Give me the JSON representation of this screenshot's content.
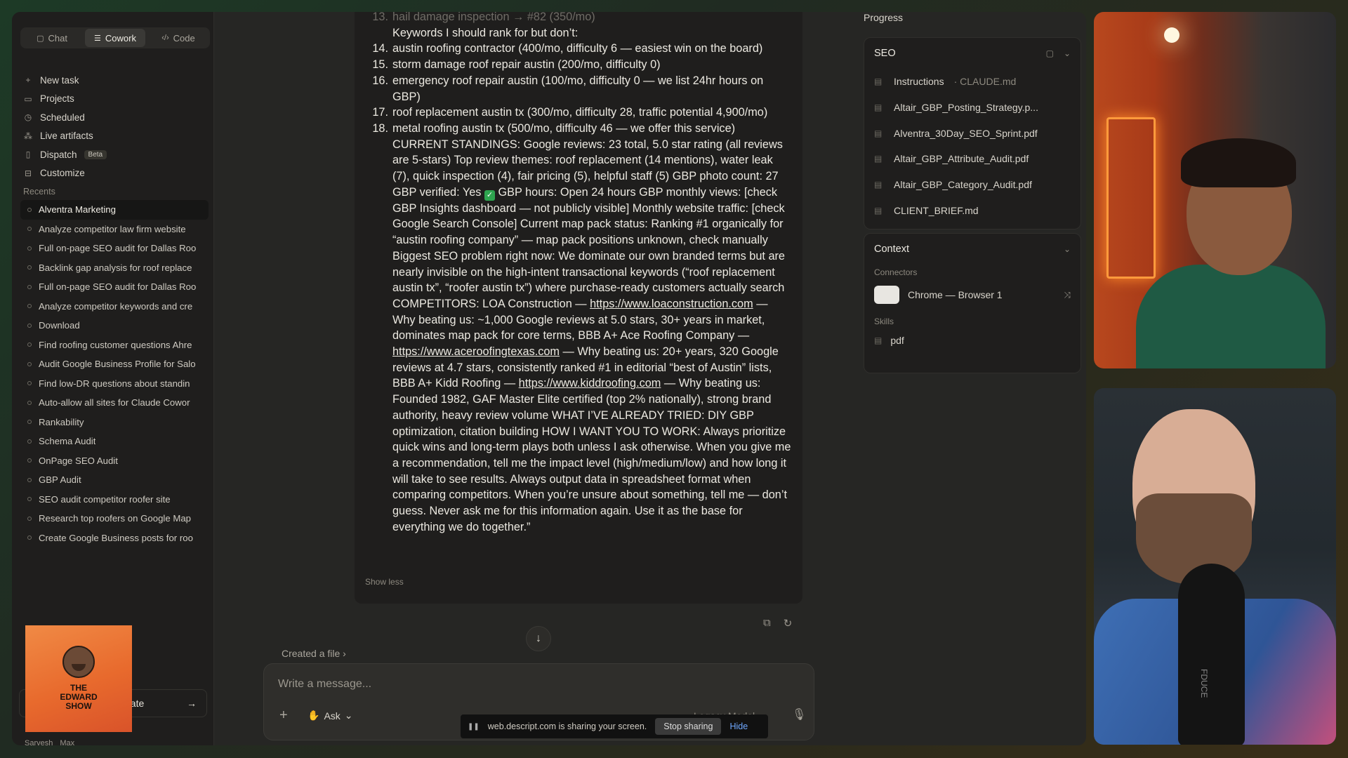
{
  "sidebar": {
    "mode_tabs": [
      {
        "label": "Chat",
        "icon": "chat-bubble-icon"
      },
      {
        "label": "Cowork",
        "icon": "cowork-icon"
      },
      {
        "label": "Code",
        "icon": "code-icon"
      }
    ],
    "nav": [
      {
        "label": "New task",
        "icon": "plus-icon"
      },
      {
        "label": "Projects",
        "icon": "folder-icon"
      },
      {
        "label": "Scheduled",
        "icon": "clock-icon"
      },
      {
        "label": "Live artifacts",
        "icon": "artifacts-icon"
      },
      {
        "label": "Dispatch",
        "icon": "dispatch-icon",
        "badge": "Beta"
      },
      {
        "label": "Customize",
        "icon": "customize-icon"
      }
    ],
    "recents_label": "Recents",
    "recents": [
      "Alventra Marketing",
      "Analyze competitor law firm website",
      "Full on-page SEO audit for Dallas Roo",
      "Backlink gap analysis for roof replace",
      "Full on-page SEO audit for Dallas Roo",
      "Analyze competitor keywords and cre",
      "Download",
      "Find roofing customer questions Ahre",
      "Audit Google Business Profile for Salo",
      "Find low-DR questions about standin",
      "Auto-allow all sites for Claude Cowor",
      "Rankability",
      "Schema Audit",
      "OnPage SEO Audit",
      "GBP Audit",
      "SEO audit competitor roofer site",
      "Research top roofers on Google Map",
      "Create Google Business posts for roo"
    ],
    "update_text": "date",
    "user_name": "Sarvesh",
    "user_plan": "Max",
    "podcast_title": "THE\nEDWARD\nSHOW"
  },
  "chat": {
    "list": [
      {
        "num": "13.",
        "text": "hail damage inspection → #82 (350/mo)",
        "faded": true
      },
      {
        "num": "",
        "text": "Keywords I should rank for but don’t:",
        "indent": true
      },
      {
        "num": "14.",
        "text": "austin roofing contractor (400/mo, difficulty 6 — easiest win on the board)"
      },
      {
        "num": "15.",
        "text": "storm damage roof repair austin (200/mo, difficulty 0)"
      },
      {
        "num": "16.",
        "text": "emergency roof repair austin (100/mo, difficulty 0 — we list 24hr hours on GBP)"
      },
      {
        "num": "17.",
        "text": "roof replacement austin tx (300/mo, difficulty 28, traffic potential 4,900/mo)"
      },
      {
        "num": "18.",
        "text": "metal roofing austin tx (500/mo, difficulty 46 — we offer this service)"
      }
    ],
    "para": {
      "p1": "CURRENT STANDINGS: Google reviews: 23 total, 5.0 star rating (all reviews are 5-stars) Top review themes: roof replacement (14 mentions), water leak (7), quick inspection (4), fair pricing (5), helpful staff (5) GBP photo count: 27 GBP verified: Yes",
      "p2": "GBP hours: Open 24 hours GBP monthly views: [check GBP Insights dashboard — not publicly visible] Monthly website traffic: [check Google Search Console] Current map pack status: Ranking #1 organically for “austin roofing company” — map pack positions unknown, check manually Biggest SEO problem right now: We dominate our own branded terms but are nearly invisible on the high-intent transactional keywords (“roof replacement austin tx”, “roofer austin tx”) where purchase-ready customers actually search COMPETITORS: LOA Construction —",
      "link1": "https://www.loaconstruction.com",
      "p3": "— Why beating us: ~1,000 Google reviews at 5.0 stars, 30+ years in market, dominates map pack for core terms, BBB A+ Ace Roofing Company —",
      "link2": "https://www.aceroofingtexas.com",
      "p4": "— Why beating us: 20+ years, 320 Google reviews at 4.7 stars, consistently ranked #1 in editorial “best of Austin” lists, BBB A+ Kidd Roofing —",
      "link3": "https://www.kiddroofing.com",
      "p5": "— Why beating us: Founded 1982, GAF Master Elite certified (top 2% nationally), strong brand authority, heavy review volume WHAT I’VE ALREADY TRIED: DIY GBP optimization, citation building HOW I WANT YOU TO WORK: Always prioritize quick wins and long-term plays both unless I ask otherwise. When you give me a recommendation, tell me the impact level (high/medium/low) and how long it will take to see results. Always output data in spreadsheet format when comparing competitors. When you’re unsure about something, tell me — don’t guess. Never ask me for this information again. Use it as the base for everything we do together.”"
    },
    "show_less": "Show less",
    "created_file": "Created a file",
    "composer_placeholder": "Write a message...",
    "ask_label": "Ask",
    "model_label": "Legacy Model",
    "share_text": "web.descript.com is sharing your screen.",
    "share_stop": "Stop sharing",
    "share_hide": "Hide"
  },
  "right_panel": {
    "progress_label": "Progress",
    "seo": {
      "title": "SEO",
      "files": [
        {
          "name": "Instructions",
          "sub": "· CLAUDE.md"
        },
        {
          "name": "Altair_GBP_Posting_Strategy.p..."
        },
        {
          "name": "Alventra_30Day_SEO_Sprint.pdf"
        },
        {
          "name": "Altair_GBP_Attribute_Audit.pdf"
        },
        {
          "name": "Altair_GBP_Category_Audit.pdf"
        },
        {
          "name": "CLIENT_BRIEF.md"
        }
      ]
    },
    "context": {
      "title": "Context",
      "connectors_label": "Connectors",
      "connector": "Chrome — Browser 1",
      "skills_label": "Skills",
      "skill": "pdf"
    }
  },
  "video": {
    "mic_brand": "FDUCE"
  }
}
